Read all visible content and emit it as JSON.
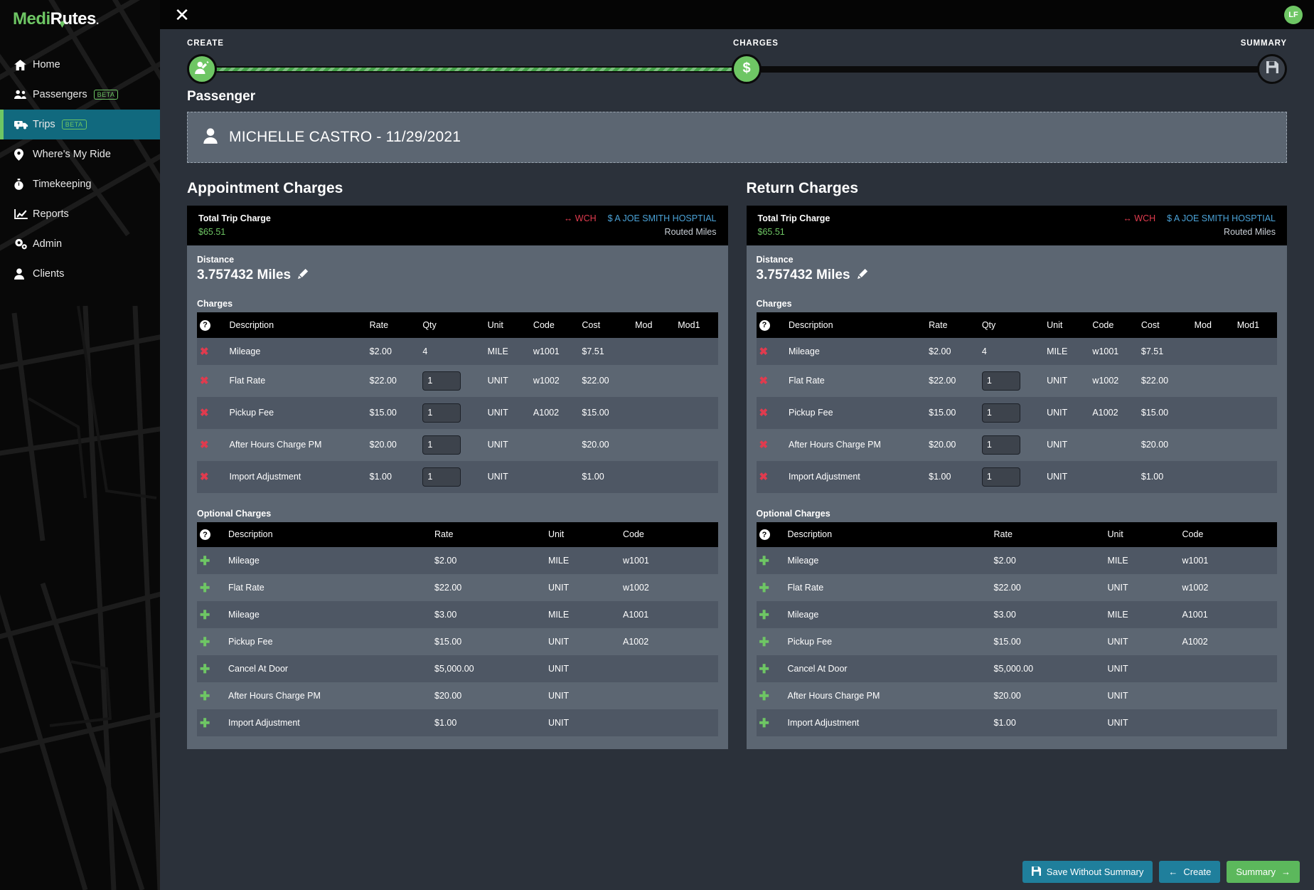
{
  "brand": {
    "part1": "Medi",
    "part2": "R",
    "part3": "utes",
    "suffix": "."
  },
  "sidebar": {
    "items": [
      {
        "label": "Home",
        "icon": "home-icon",
        "badge": "",
        "active": false
      },
      {
        "label": "Passengers",
        "icon": "users-icon",
        "badge": "BETA",
        "active": false
      },
      {
        "label": "Trips",
        "icon": "ambulance-icon",
        "badge": "BETA",
        "active": true
      },
      {
        "label": "Where's My Ride",
        "icon": "map-pin-icon",
        "badge": "",
        "active": false
      },
      {
        "label": "Timekeeping",
        "icon": "stopwatch-icon",
        "badge": "",
        "active": false
      },
      {
        "label": "Reports",
        "icon": "chart-line-icon",
        "badge": "",
        "active": false
      },
      {
        "label": "Admin",
        "icon": "gears-icon",
        "badge": "",
        "active": false
      },
      {
        "label": "Clients",
        "icon": "user-icon",
        "badge": "",
        "active": false
      }
    ]
  },
  "topbar": {
    "close_label": "✕",
    "avatar_initials": "LF"
  },
  "stepper": {
    "steps": [
      {
        "label": "CREATE",
        "state": "done",
        "icon": "user-edit-icon"
      },
      {
        "label": "CHARGES",
        "state": "done",
        "icon": "dollar-icon"
      },
      {
        "label": "SUMMARY",
        "state": "todo",
        "icon": "save-icon"
      }
    ]
  },
  "passenger": {
    "section_label": "Passenger",
    "name_date": "MICHELLE CASTRO - 11/29/2021"
  },
  "columns": [
    {
      "heading": "Appointment Charges",
      "total_label": "Total Trip Charge",
      "total_amount": "$65.51",
      "tag_wch": "WCH",
      "tag_facility": "A JOE SMITH HOSPTIAL",
      "routed_label": "Routed Miles",
      "distance_label": "Distance",
      "distance_value": "3.757432 Miles",
      "charges_label": "Charges",
      "charges_headers": [
        "Description",
        "Rate",
        "Qty",
        "Unit",
        "Code",
        "Cost",
        "Mod",
        "Mod1"
      ],
      "charges_rows": [
        {
          "desc": "Mileage",
          "rate": "$2.00",
          "qty": "4",
          "qty_input": false,
          "unit": "MILE",
          "code": "w1001",
          "cost": "$7.51",
          "mod": "",
          "mod1": ""
        },
        {
          "desc": "Flat Rate",
          "rate": "$22.00",
          "qty": "1",
          "qty_input": true,
          "unit": "UNIT",
          "code": "w1002",
          "cost": "$22.00",
          "mod": "",
          "mod1": ""
        },
        {
          "desc": "Pickup Fee",
          "rate": "$15.00",
          "qty": "1",
          "qty_input": true,
          "unit": "UNIT",
          "code": "A1002",
          "cost": "$15.00",
          "mod": "",
          "mod1": ""
        },
        {
          "desc": "After Hours Charge PM",
          "rate": "$20.00",
          "qty": "1",
          "qty_input": true,
          "unit": "UNIT",
          "code": "",
          "cost": "$20.00",
          "mod": "",
          "mod1": ""
        },
        {
          "desc": "Import Adjustment",
          "rate": "$1.00",
          "qty": "1",
          "qty_input": true,
          "unit": "UNIT",
          "code": "",
          "cost": "$1.00",
          "mod": "",
          "mod1": ""
        }
      ],
      "optional_label": "Optional Charges",
      "optional_headers": [
        "Description",
        "Rate",
        "Unit",
        "Code"
      ],
      "optional_rows": [
        {
          "desc": "Mileage",
          "rate": "$2.00",
          "unit": "MILE",
          "code": "w1001"
        },
        {
          "desc": "Flat Rate",
          "rate": "$22.00",
          "unit": "UNIT",
          "code": "w1002"
        },
        {
          "desc": "Mileage",
          "rate": "$3.00",
          "unit": "MILE",
          "code": "A1001"
        },
        {
          "desc": "Pickup Fee",
          "rate": "$15.00",
          "unit": "UNIT",
          "code": "A1002"
        },
        {
          "desc": "Cancel At Door",
          "rate": "$5,000.00",
          "unit": "UNIT",
          "code": ""
        },
        {
          "desc": "After Hours Charge PM",
          "rate": "$20.00",
          "unit": "UNIT",
          "code": ""
        },
        {
          "desc": "Import Adjustment",
          "rate": "$1.00",
          "unit": "UNIT",
          "code": ""
        }
      ]
    },
    {
      "heading": "Return Charges",
      "total_label": "Total Trip Charge",
      "total_amount": "$65.51",
      "tag_wch": "WCH",
      "tag_facility": "A JOE SMITH HOSPTIAL",
      "routed_label": "Routed Miles",
      "distance_label": "Distance",
      "distance_value": "3.757432 Miles",
      "charges_label": "Charges",
      "charges_headers": [
        "Description",
        "Rate",
        "Qty",
        "Unit",
        "Code",
        "Cost",
        "Mod",
        "Mod1"
      ],
      "charges_rows": [
        {
          "desc": "Mileage",
          "rate": "$2.00",
          "qty": "4",
          "qty_input": false,
          "unit": "MILE",
          "code": "w1001",
          "cost": "$7.51",
          "mod": "",
          "mod1": ""
        },
        {
          "desc": "Flat Rate",
          "rate": "$22.00",
          "qty": "1",
          "qty_input": true,
          "unit": "UNIT",
          "code": "w1002",
          "cost": "$22.00",
          "mod": "",
          "mod1": ""
        },
        {
          "desc": "Pickup Fee",
          "rate": "$15.00",
          "qty": "1",
          "qty_input": true,
          "unit": "UNIT",
          "code": "A1002",
          "cost": "$15.00",
          "mod": "",
          "mod1": ""
        },
        {
          "desc": "After Hours Charge PM",
          "rate": "$20.00",
          "qty": "1",
          "qty_input": true,
          "unit": "UNIT",
          "code": "",
          "cost": "$20.00",
          "mod": "",
          "mod1": ""
        },
        {
          "desc": "Import Adjustment",
          "rate": "$1.00",
          "qty": "1",
          "qty_input": true,
          "unit": "UNIT",
          "code": "",
          "cost": "$1.00",
          "mod": "",
          "mod1": ""
        }
      ],
      "optional_label": "Optional Charges",
      "optional_headers": [
        "Description",
        "Rate",
        "Unit",
        "Code"
      ],
      "optional_rows": [
        {
          "desc": "Mileage",
          "rate": "$2.00",
          "unit": "MILE",
          "code": "w1001"
        },
        {
          "desc": "Flat Rate",
          "rate": "$22.00",
          "unit": "UNIT",
          "code": "w1002"
        },
        {
          "desc": "Mileage",
          "rate": "$3.00",
          "unit": "MILE",
          "code": "A1001"
        },
        {
          "desc": "Pickup Fee",
          "rate": "$15.00",
          "unit": "UNIT",
          "code": "A1002"
        },
        {
          "desc": "Cancel At Door",
          "rate": "$5,000.00",
          "unit": "UNIT",
          "code": ""
        },
        {
          "desc": "After Hours Charge PM",
          "rate": "$20.00",
          "unit": "UNIT",
          "code": ""
        },
        {
          "desc": "Import Adjustment",
          "rate": "$1.00",
          "unit": "UNIT",
          "code": ""
        }
      ]
    }
  ],
  "footer": {
    "save_label": "Save Without Summary",
    "create_label": "Create",
    "summary_label": "Summary"
  },
  "colors": {
    "accent_green": "#6ec664",
    "accent_teal": "#11697e",
    "panel": "#5c6672",
    "panel_alt": "#4e5764",
    "app_bg": "#2b313a",
    "danger": "#e03b4e",
    "link_blue": "#4ba3d8"
  }
}
